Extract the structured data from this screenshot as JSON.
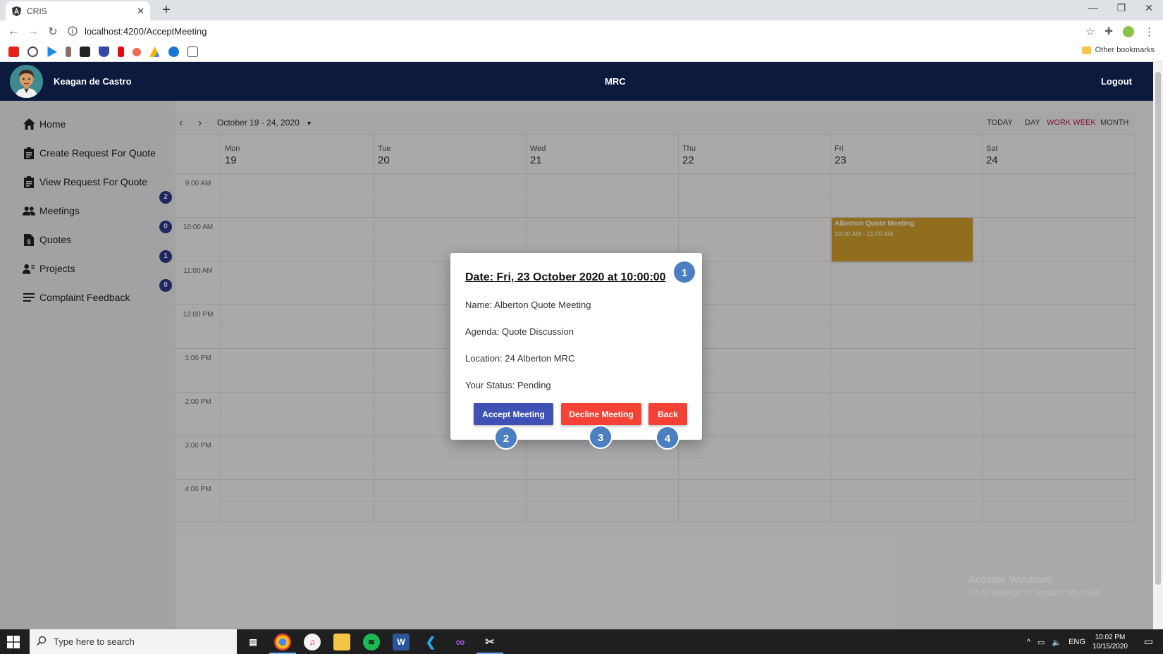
{
  "browser": {
    "tab_title": "CRIS",
    "url": "localhost:4200/AcceptMeeting",
    "other_bookmarks": "Other bookmarks"
  },
  "header": {
    "username": "Keagan de Castro",
    "app_title": "MRC",
    "logout": "Logout"
  },
  "sidebar": {
    "items": [
      {
        "label": "Home"
      },
      {
        "label": "Create Request For Quote"
      },
      {
        "label": "View Request For Quote",
        "badge": "2"
      },
      {
        "label": "Meetings",
        "badge": "0"
      },
      {
        "label": "Quotes",
        "badge": "1"
      },
      {
        "label": "Projects",
        "badge": "0"
      },
      {
        "label": "Complaint Feedback"
      }
    ]
  },
  "calendar": {
    "range": "October 19 - 24, 2020",
    "views": [
      "TODAY",
      "DAY",
      "WORK WEEK",
      "MONTH"
    ],
    "active_view": "WORK WEEK",
    "days": [
      {
        "name": "Mon",
        "num": "19"
      },
      {
        "name": "Tue",
        "num": "20"
      },
      {
        "name": "Wed",
        "num": "21"
      },
      {
        "name": "Thu",
        "num": "22"
      },
      {
        "name": "Fri",
        "num": "23"
      },
      {
        "name": "Sat",
        "num": "24"
      }
    ],
    "times": [
      "9:00 AM",
      "10:00 AM",
      "11:00 AM",
      "12:00 PM",
      "1:00 PM",
      "2:00 PM",
      "3:00 PM",
      "4:00 PM"
    ],
    "event": {
      "name": "Alberton Quote Meeting",
      "time": "10:00 AM - 11:00 AM",
      "color": "#d4a32c"
    }
  },
  "dialog": {
    "title": "Date: Fri, 23 October 2020 at 10:00:00",
    "name": "Name: Alberton Quote Meeting",
    "agenda": "Agenda: Quote Discussion",
    "location": "Location: 24 Alberton MRC",
    "status": "Your Status: Pending",
    "accept_label": "Accept Meeting",
    "decline_label": "Decline Meeting",
    "back_label": "Back"
  },
  "callouts": [
    "1",
    "2",
    "3",
    "4"
  ],
  "watermark": {
    "line1": "Activate Windows",
    "line2": "Go to Settings to activate Windows."
  },
  "taskbar": {
    "search_placeholder": "Type here to search",
    "lang": "ENG",
    "time": "10:02 PM",
    "date": "10/15/2020"
  },
  "colors": {
    "header_bg": "#0b1a3d",
    "accept": "#3f51b5",
    "decline": "#f44336",
    "badge": "#2d3a8c",
    "callout": "#4a7fc1"
  }
}
